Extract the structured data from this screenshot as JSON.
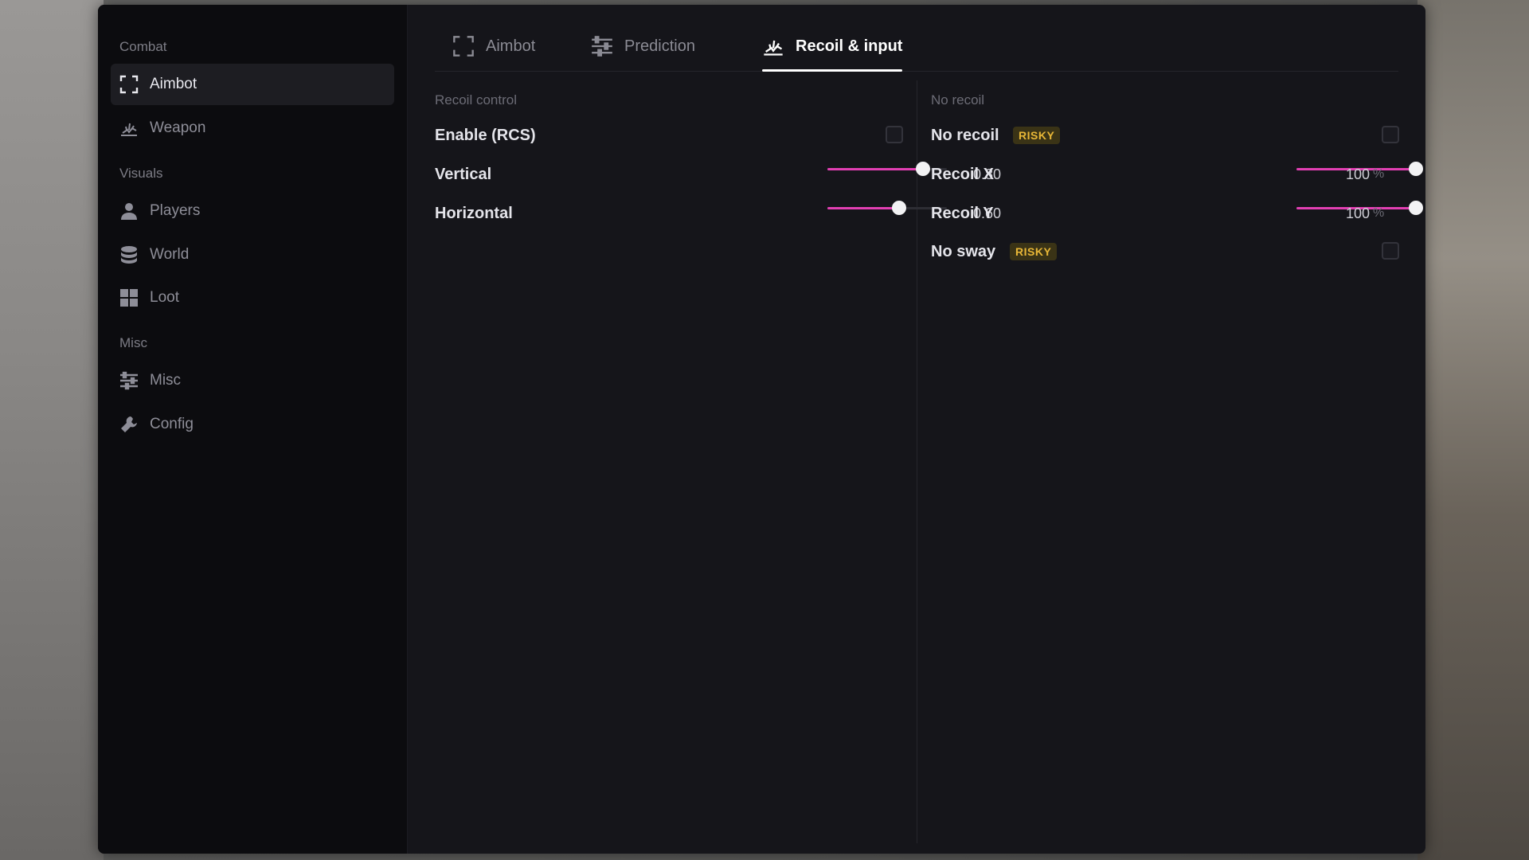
{
  "sidebar": {
    "sections": [
      {
        "label": "Combat",
        "items": [
          {
            "label": "Aimbot",
            "icon": "crosshair-frame-icon",
            "active": true
          },
          {
            "label": "Weapon",
            "icon": "weapon-burst-icon"
          }
        ]
      },
      {
        "label": "Visuals",
        "items": [
          {
            "label": "Players",
            "icon": "person-icon"
          },
          {
            "label": "World",
            "icon": "database-icon"
          },
          {
            "label": "Loot",
            "icon": "grid-icon"
          }
        ]
      },
      {
        "label": "Misc",
        "items": [
          {
            "label": "Misc",
            "icon": "sliders-icon"
          },
          {
            "label": "Config",
            "icon": "wrench-icon"
          }
        ]
      }
    ]
  },
  "tabs": [
    {
      "label": "Aimbot",
      "icon": "crosshair-frame-icon"
    },
    {
      "label": "Prediction",
      "icon": "sliders-icon"
    },
    {
      "label": "Recoil & input",
      "icon": "weapon-burst-icon",
      "active": true
    }
  ],
  "recoil_control": {
    "title": "Recoil control",
    "enable": {
      "label": "Enable (RCS)",
      "checked": false
    },
    "vertical": {
      "label": "Vertical",
      "value": "0.80",
      "fraction": 0.8
    },
    "horizontal": {
      "label": "Horizontal",
      "value": "0.60",
      "fraction": 0.6
    }
  },
  "no_recoil": {
    "title": "No recoil",
    "no_recoil": {
      "label": "No recoil",
      "badge": "RISKY",
      "checked": false
    },
    "recoil_x": {
      "label": "Recoil X",
      "value": "100",
      "unit": "%",
      "fraction": 1.0
    },
    "recoil_y": {
      "label": "Recoil Y",
      "value": "100",
      "unit": "%",
      "fraction": 1.0
    },
    "no_sway": {
      "label": "No sway",
      "badge": "RISKY",
      "checked": false
    }
  },
  "colors": {
    "accent": "#e23fb3",
    "badge_text": "#e8b737",
    "background": "#15151a"
  }
}
